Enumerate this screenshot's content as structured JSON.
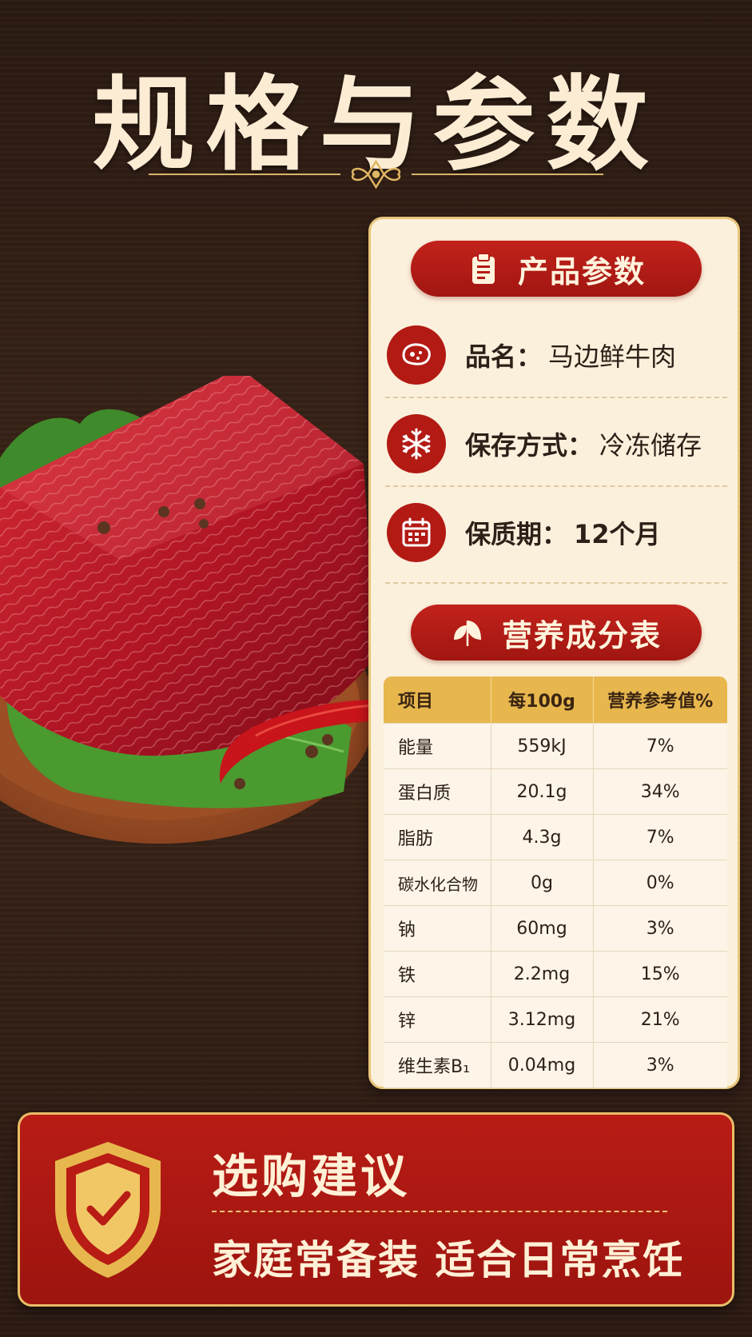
{
  "page": {
    "title": "规格与参数"
  },
  "product_section": {
    "header": "产品参数",
    "header_icon": "clipboard-icon",
    "rows": [
      {
        "label": "品名：",
        "value": "马边鲜牛肉",
        "icon": "meat-icon"
      },
      {
        "label": "保存方式：",
        "value": "冷冻储存",
        "icon": "snowflake-icon"
      },
      {
        "label": "保质期：",
        "value": "12个月",
        "icon": "calendar-icon"
      }
    ]
  },
  "nutrition_section": {
    "header": "营养成分表",
    "header_icon": "leaf-icon",
    "columns": [
      "项目",
      "每100g",
      "营养参考值%"
    ],
    "rows": [
      [
        "能量",
        "559kJ",
        "7%"
      ],
      [
        "蛋白质",
        "20.1g",
        "34%"
      ],
      [
        "脂肪",
        "4.3g",
        "7%"
      ],
      [
        "碳水化合物",
        "0g",
        "0%"
      ],
      [
        "钠",
        "60mg",
        "3%"
      ],
      [
        "铁",
        "2.2mg",
        "15%"
      ],
      [
        "锌",
        "3.12mg",
        "21%"
      ],
      [
        "维生素B₁",
        "0.04mg",
        "3%"
      ]
    ]
  },
  "banner": {
    "title": "选购建议",
    "text": "家庭常备装 适合日常烹饪",
    "icon": "shield-check-icon"
  },
  "colors": {
    "primary_red": "#b31a14",
    "gold": "#e7b74e",
    "cream": "#fbf0dc",
    "title_cream": "#fbecd3"
  }
}
